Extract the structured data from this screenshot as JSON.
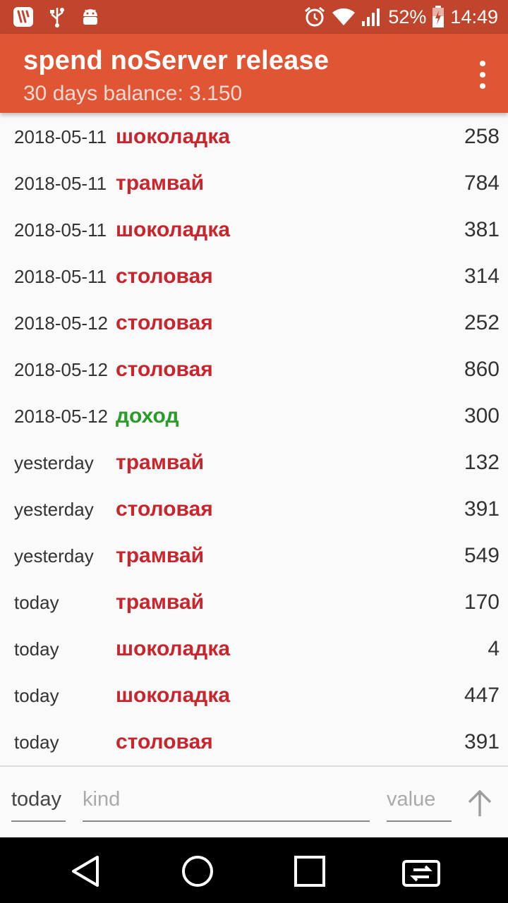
{
  "status_bar": {
    "battery": "52%",
    "time": "14:49",
    "icons": [
      "flowdock-notification-icon",
      "usb-icon",
      "android-debug-icon",
      "alarm-icon",
      "wifi-icon",
      "signal-icon",
      "battery-charging-icon"
    ]
  },
  "app_bar": {
    "title": "spend noServer release",
    "subtitle": "30 days balance: 3.150",
    "menu_icon": "overflow-menu-icon"
  },
  "entries": [
    {
      "date": "2018-05-11",
      "kind": "шоколадка",
      "value": "258",
      "type": "expense"
    },
    {
      "date": "2018-05-11",
      "kind": "трамвай",
      "value": "784",
      "type": "expense"
    },
    {
      "date": "2018-05-11",
      "kind": "шоколадка",
      "value": "381",
      "type": "expense"
    },
    {
      "date": "2018-05-11",
      "kind": "столовая",
      "value": "314",
      "type": "expense"
    },
    {
      "date": "2018-05-12",
      "kind": "столовая",
      "value": "252",
      "type": "expense"
    },
    {
      "date": "2018-05-12",
      "kind": "столовая",
      "value": "860",
      "type": "expense"
    },
    {
      "date": "2018-05-12",
      "kind": "доход",
      "value": "300",
      "type": "income"
    },
    {
      "date": "yesterday",
      "kind": "трамвай",
      "value": "132",
      "type": "expense"
    },
    {
      "date": "yesterday",
      "kind": "столовая",
      "value": "391",
      "type": "expense"
    },
    {
      "date": "yesterday",
      "kind": "трамвай",
      "value": "549",
      "type": "expense"
    },
    {
      "date": "today",
      "kind": "трамвай",
      "value": "170",
      "type": "expense"
    },
    {
      "date": "today",
      "kind": "шоколадка",
      "value": "4",
      "type": "expense"
    },
    {
      "date": "today",
      "kind": "шоколадка",
      "value": "447",
      "type": "expense"
    },
    {
      "date": "today",
      "kind": "столовая",
      "value": "391",
      "type": "expense"
    }
  ],
  "input_bar": {
    "date_value": "today",
    "kind_placeholder": "kind",
    "value_placeholder": "value",
    "send_icon": "arrow-up-icon"
  },
  "nav_bar": {
    "icons": [
      "back-icon",
      "home-icon",
      "recents-icon",
      "screen-mirror-icon"
    ]
  },
  "colors": {
    "status_bar": "#c1452d",
    "app_bar": "#e05635",
    "expense": "#c8252d",
    "income": "#2a9c2a"
  }
}
